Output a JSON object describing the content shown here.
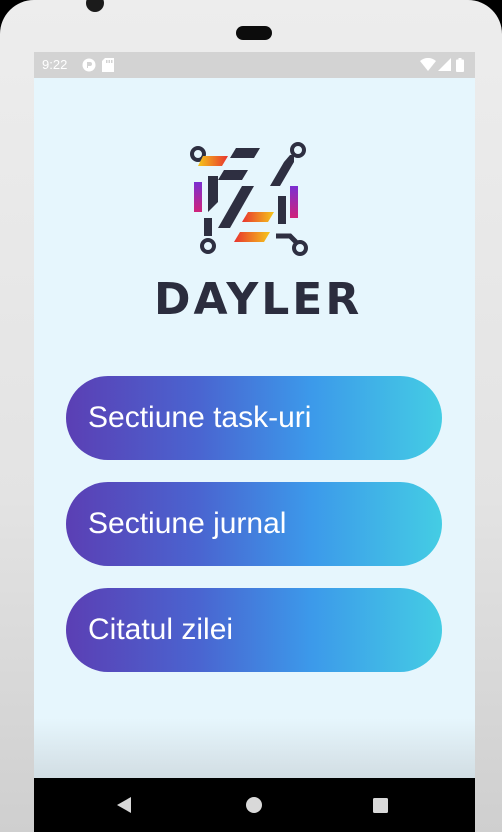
{
  "status_bar": {
    "time": "9:22",
    "left_icons": [
      "settings-circle-icon",
      "sd-card-icon"
    ],
    "right_icons": [
      "wifi-icon",
      "signal-icon",
      "battery-icon"
    ]
  },
  "app": {
    "brand_name": "DAYLER",
    "logo_icon": "dayler-logo-icon",
    "colors": {
      "background": "#e6f6fd",
      "button_start": "#5b3fb4",
      "button_end": "#44cde4",
      "brand_text": "#2b2d3e"
    }
  },
  "menu": {
    "buttons": [
      {
        "label": "Sectiune task-uri"
      },
      {
        "label": "Sectiune jurnal"
      },
      {
        "label": "Citatul zilei"
      }
    ]
  },
  "nav_bar": {
    "items": [
      "back-icon",
      "home-icon",
      "recents-icon"
    ]
  }
}
